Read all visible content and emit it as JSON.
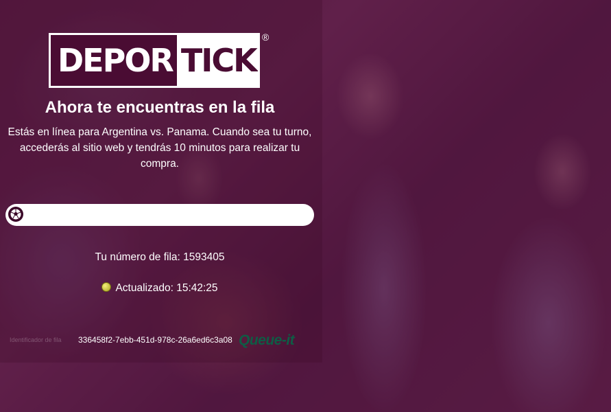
{
  "brand": {
    "logo_part1": "DEPOR",
    "logo_part2": "TICK",
    "registered": "®"
  },
  "queue": {
    "title": "Ahora te encuentras en la fila",
    "description": "Estás en línea para Argentina vs. Panama. Cuando sea tu turno, accederás al sitio web y tendrás 10 minutos para realizar tu compra.",
    "queue_number_label": "Tu número de fila: 1593405",
    "updated_label": "Actualizado: 15:42:25",
    "queue_id_label": "Identificador de fila",
    "queue_id_value": "336458f2-7ebb-451d-978c-26a6ed6c3a08",
    "provider": "Queue-it"
  },
  "progress": {
    "value": 0
  },
  "colors": {
    "brand": "#4a0c33",
    "status_dot": "#d6d040",
    "provider": "#0f5c45"
  },
  "icons": {
    "progress": "soccer-ball-icon",
    "status": "status-dot-icon"
  }
}
